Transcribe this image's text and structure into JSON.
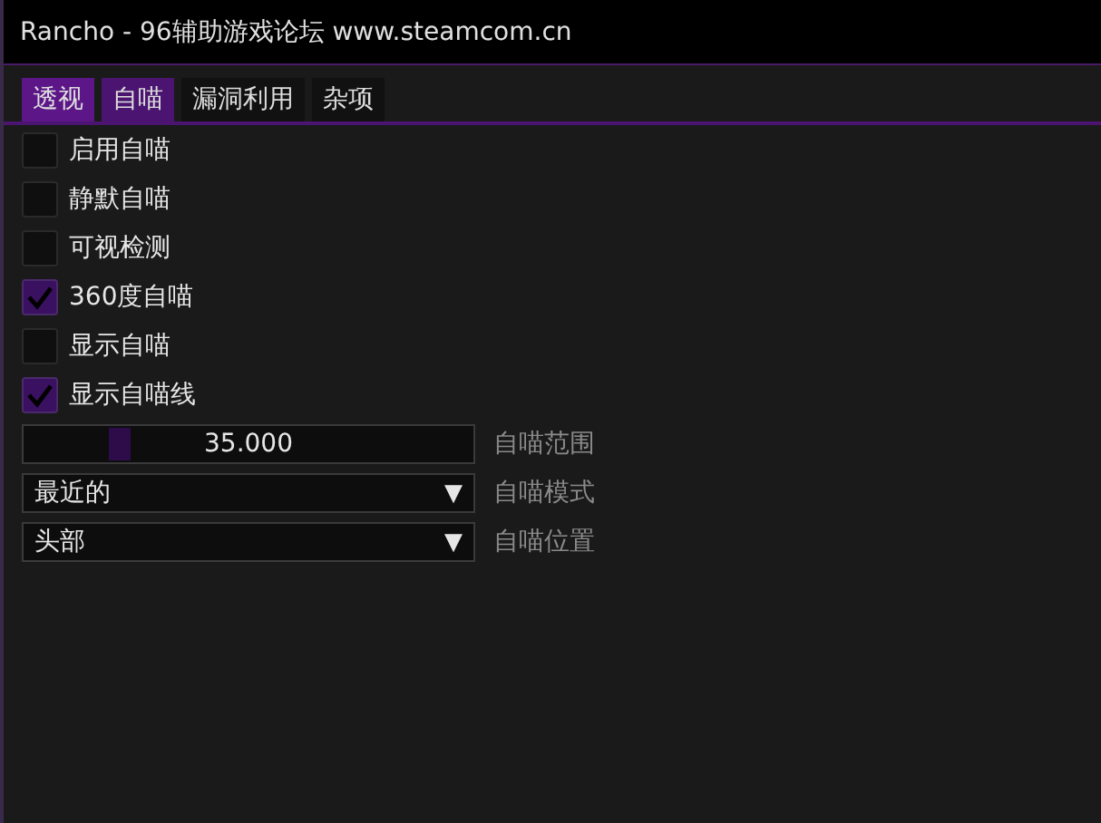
{
  "window": {
    "title": "Rancho - 96辅助游戏论坛 www.steamcom.cn"
  },
  "tabs": [
    {
      "label": "透视",
      "selected": false,
      "hovered": true
    },
    {
      "label": "自喵",
      "selected": true,
      "hovered": false
    },
    {
      "label": "漏洞利用",
      "selected": false,
      "hovered": false
    },
    {
      "label": "杂项",
      "selected": false,
      "hovered": false
    }
  ],
  "controls": [
    {
      "kind": "checkbox",
      "label": "启用自喵",
      "checked": false
    },
    {
      "kind": "checkbox",
      "label": "静默自喵",
      "checked": false
    },
    {
      "kind": "checkbox",
      "label": "可视检测",
      "checked": false
    },
    {
      "kind": "checkbox",
      "label": "360度自喵",
      "checked": true
    },
    {
      "kind": "checkbox",
      "label": "显示自喵",
      "checked": false
    },
    {
      "kind": "checkbox",
      "label": "显示自喵线",
      "checked": true
    },
    {
      "kind": "slider",
      "label": "自喵范围",
      "reading": "35.000",
      "level": 0.2
    },
    {
      "kind": "dropdown",
      "label": "自喵模式",
      "value": "最近的",
      "arrow": "▼"
    },
    {
      "kind": "dropdown",
      "label": "自喵位置",
      "value": "头部",
      "arrow": "▼"
    }
  ]
}
